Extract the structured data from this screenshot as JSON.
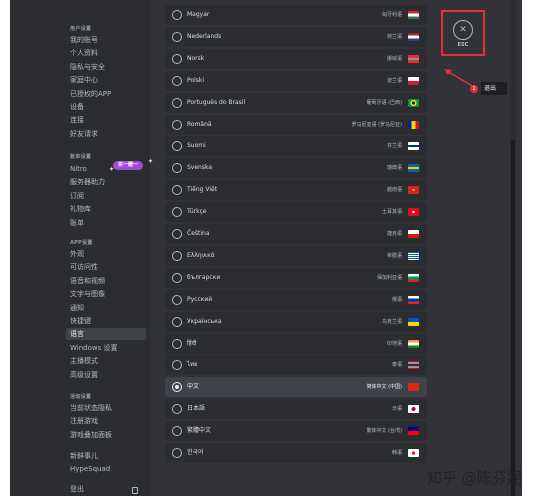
{
  "sidebar": {
    "sections": [
      {
        "header": "用户设置",
        "items": [
          "我的账号",
          "个人资料",
          "隐私与安全",
          "家庭中心",
          "已授权的APP",
          "设备",
          "连接",
          "好友请求"
        ]
      },
      {
        "header": "账单设置",
        "items": [
          "Nitro",
          "服务器助力",
          "订阅",
          "礼物库",
          "账单"
        ]
      },
      {
        "header": "APP设置",
        "items": [
          "外观",
          "可访问性",
          "语音和视频",
          "文字与图像",
          "通知",
          "快捷键",
          "语言",
          "Windows 设置",
          "主播模式",
          "高级设置"
        ]
      },
      {
        "header": "活动设置",
        "items": [
          "当前状态隐私",
          "注册游戏",
          "游戏叠加面板"
        ]
      },
      {
        "header": "",
        "items": [
          "新鲜事儿",
          "HypeSquad"
        ]
      },
      {
        "header": "",
        "items": [
          "登出"
        ]
      }
    ],
    "active_item": "语言",
    "nitro_badge": "买一赠一",
    "colors": {
      "nitro_badge": "#a349d7",
      "active_bg": "#404249"
    }
  },
  "languages": [
    {
      "name": "Magyar",
      "native": "匈牙利语",
      "flag": "hu",
      "selected": false
    },
    {
      "name": "Nederlands",
      "native": "荷兰语",
      "flag": "nl",
      "selected": false
    },
    {
      "name": "Norsk",
      "native": "挪威语",
      "flag": "no",
      "selected": false
    },
    {
      "name": "Polski",
      "native": "波兰语",
      "flag": "pl",
      "selected": false
    },
    {
      "name": "Português do Brasil",
      "native": "葡萄牙语 (巴西)",
      "flag": "br",
      "selected": false
    },
    {
      "name": "Română",
      "native": "罗马尼亚语 (罗马尼亚)",
      "flag": "ro",
      "selected": false
    },
    {
      "name": "Suomi",
      "native": "芬兰语",
      "flag": "fi",
      "selected": false
    },
    {
      "name": "Svenska",
      "native": "瑞典语",
      "flag": "se",
      "selected": false
    },
    {
      "name": "Tiếng Việt",
      "native": "越南语",
      "flag": "vn",
      "selected": false
    },
    {
      "name": "Türkçe",
      "native": "土耳其语",
      "flag": "tr",
      "selected": false
    },
    {
      "name": "Čeština",
      "native": "捷克语",
      "flag": "cz",
      "selected": false
    },
    {
      "name": "Ελληνικά",
      "native": "希腊语",
      "flag": "gr",
      "selected": false
    },
    {
      "name": "български",
      "native": "保加利亚语",
      "flag": "bg",
      "selected": false
    },
    {
      "name": "Русский",
      "native": "俄语",
      "flag": "ru",
      "selected": false
    },
    {
      "name": "Українська",
      "native": "乌克兰语",
      "flag": "ua",
      "selected": false
    },
    {
      "name": "हिंदी",
      "native": "印地语",
      "flag": "in",
      "selected": false
    },
    {
      "name": "ไทย",
      "native": "泰语",
      "flag": "th",
      "selected": false
    },
    {
      "name": "中文",
      "native": "简体中文 (中国)",
      "flag": "cn",
      "selected": true
    },
    {
      "name": "日本語",
      "native": "日语",
      "flag": "jp",
      "selected": false
    },
    {
      "name": "繁體中文",
      "native": "繁体中文 (台湾)",
      "flag": "tw",
      "selected": false
    },
    {
      "name": "한국어",
      "native": "韩语",
      "flag": "kr",
      "selected": false
    }
  ],
  "esc": {
    "icon": "close-icon",
    "label": "ESC"
  },
  "annotation": {
    "step": "1",
    "text": "退出",
    "color": "#e8303a"
  },
  "watermark": "知乎 @陈芬妮"
}
